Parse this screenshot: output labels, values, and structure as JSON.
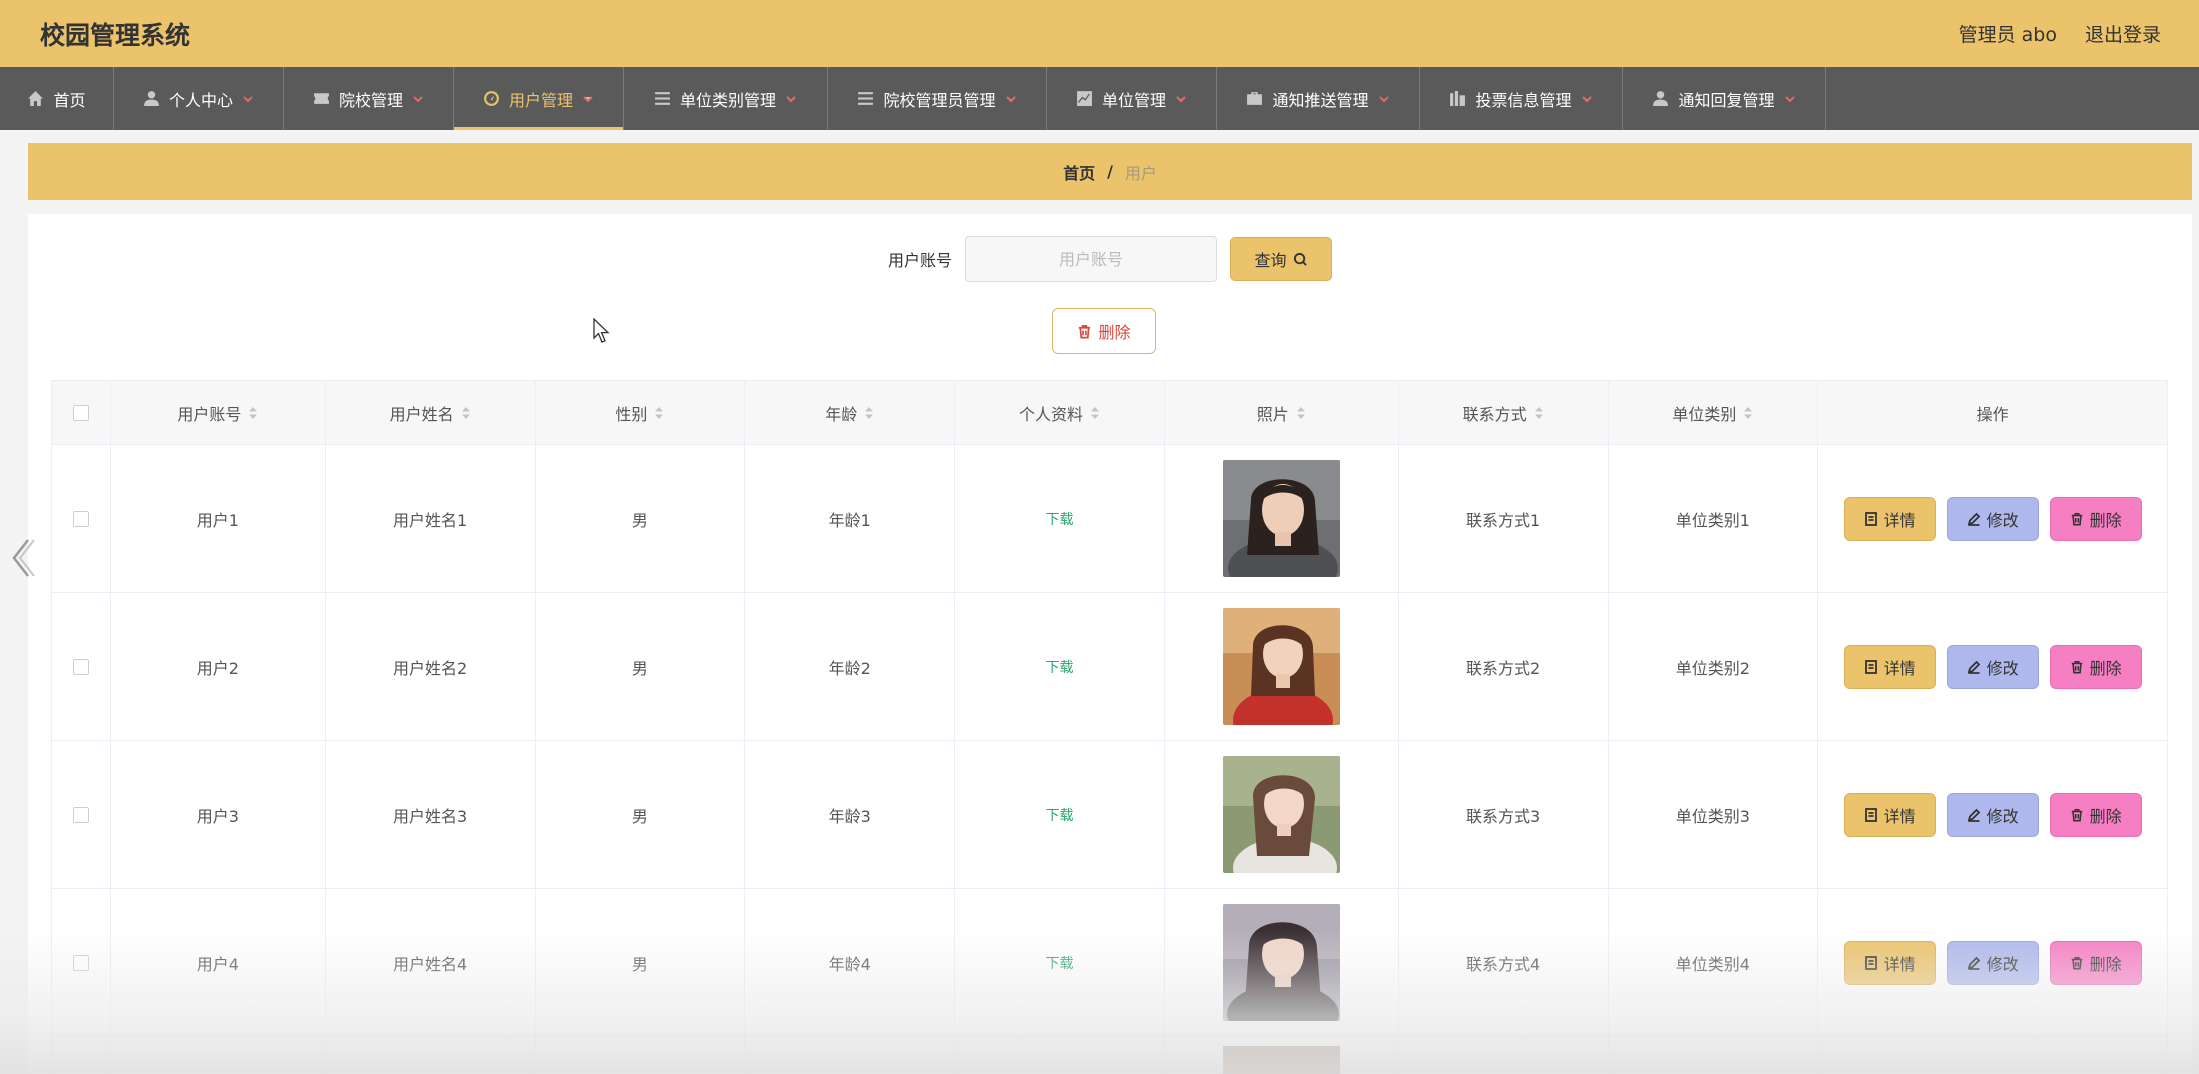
{
  "header": {
    "title": "校园管理系统",
    "user_label": "管理员 abo",
    "logout_label": "退出登录"
  },
  "nav": {
    "items": [
      {
        "label": "首页",
        "icon": "home-icon",
        "dropdown": false
      },
      {
        "label": "个人中心",
        "icon": "user-icon",
        "dropdown": true
      },
      {
        "label": "院校管理",
        "icon": "ticket-icon",
        "dropdown": true
      },
      {
        "label": "用户管理",
        "icon": "gauge-icon",
        "dropdown": true,
        "active": true
      },
      {
        "label": "单位类别管理",
        "icon": "list-icon",
        "dropdown": true
      },
      {
        "label": "院校管理员管理",
        "icon": "list-icon",
        "dropdown": true
      },
      {
        "label": "单位管理",
        "icon": "chart-icon",
        "dropdown": true
      },
      {
        "label": "通知推送管理",
        "icon": "briefcase-icon",
        "dropdown": true
      },
      {
        "label": "投票信息管理",
        "icon": "bars-icon",
        "dropdown": true
      },
      {
        "label": "通知回复管理",
        "icon": "user-icon",
        "dropdown": true
      }
    ]
  },
  "breadcrumb": {
    "home": "首页",
    "separator": "/",
    "current": "用户"
  },
  "search": {
    "label": "用户账号",
    "placeholder": "用户账号",
    "query_label": "查询"
  },
  "toolbar": {
    "delete_label": "删除"
  },
  "table": {
    "headers": [
      "用户账号",
      "用户姓名",
      "性别",
      "年龄",
      "个人资料",
      "照片",
      "联系方式",
      "单位类别",
      "操作"
    ],
    "rows": [
      {
        "account": "用户1",
        "name": "用户姓名1",
        "gender": "男",
        "age": "年龄1",
        "profile": "下载",
        "contact": "联系方式1",
        "category": "单位类别1"
      },
      {
        "account": "用户2",
        "name": "用户姓名2",
        "gender": "男",
        "age": "年龄2",
        "profile": "下载",
        "contact": "联系方式2",
        "category": "单位类别2"
      },
      {
        "account": "用户3",
        "name": "用户姓名3",
        "gender": "男",
        "age": "年龄3",
        "profile": "下载",
        "contact": "联系方式3",
        "category": "单位类别3"
      },
      {
        "account": "用户4",
        "name": "用户姓名4",
        "gender": "男",
        "age": "年龄4",
        "profile": "下载",
        "contact": "联系方式4",
        "category": "单位类别4"
      }
    ],
    "actions": {
      "detail": "详情",
      "edit": "修改",
      "delete": "删除"
    }
  },
  "colors": {
    "accent": "#ebc36b",
    "nav_bg": "#5a5a5a",
    "edit_btn": "#aeb8ec",
    "delete_btn": "#f67fc4",
    "download_link": "#2aa76f"
  }
}
